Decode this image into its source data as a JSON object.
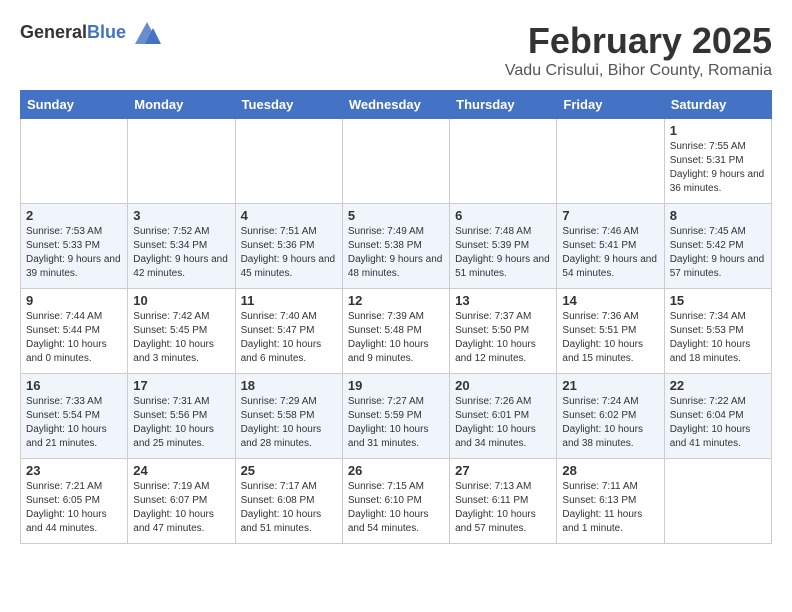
{
  "logo": {
    "general": "General",
    "blue": "Blue"
  },
  "title": "February 2025",
  "subtitle": "Vadu Crisului, Bihor County, Romania",
  "weekdays": [
    "Sunday",
    "Monday",
    "Tuesday",
    "Wednesday",
    "Thursday",
    "Friday",
    "Saturday"
  ],
  "weeks": [
    [
      {
        "day": "",
        "info": ""
      },
      {
        "day": "",
        "info": ""
      },
      {
        "day": "",
        "info": ""
      },
      {
        "day": "",
        "info": ""
      },
      {
        "day": "",
        "info": ""
      },
      {
        "day": "",
        "info": ""
      },
      {
        "day": "1",
        "info": "Sunrise: 7:55 AM\nSunset: 5:31 PM\nDaylight: 9 hours and 36 minutes."
      }
    ],
    [
      {
        "day": "2",
        "info": "Sunrise: 7:53 AM\nSunset: 5:33 PM\nDaylight: 9 hours and 39 minutes."
      },
      {
        "day": "3",
        "info": "Sunrise: 7:52 AM\nSunset: 5:34 PM\nDaylight: 9 hours and 42 minutes."
      },
      {
        "day": "4",
        "info": "Sunrise: 7:51 AM\nSunset: 5:36 PM\nDaylight: 9 hours and 45 minutes."
      },
      {
        "day": "5",
        "info": "Sunrise: 7:49 AM\nSunset: 5:38 PM\nDaylight: 9 hours and 48 minutes."
      },
      {
        "day": "6",
        "info": "Sunrise: 7:48 AM\nSunset: 5:39 PM\nDaylight: 9 hours and 51 minutes."
      },
      {
        "day": "7",
        "info": "Sunrise: 7:46 AM\nSunset: 5:41 PM\nDaylight: 9 hours and 54 minutes."
      },
      {
        "day": "8",
        "info": "Sunrise: 7:45 AM\nSunset: 5:42 PM\nDaylight: 9 hours and 57 minutes."
      }
    ],
    [
      {
        "day": "9",
        "info": "Sunrise: 7:44 AM\nSunset: 5:44 PM\nDaylight: 10 hours and 0 minutes."
      },
      {
        "day": "10",
        "info": "Sunrise: 7:42 AM\nSunset: 5:45 PM\nDaylight: 10 hours and 3 minutes."
      },
      {
        "day": "11",
        "info": "Sunrise: 7:40 AM\nSunset: 5:47 PM\nDaylight: 10 hours and 6 minutes."
      },
      {
        "day": "12",
        "info": "Sunrise: 7:39 AM\nSunset: 5:48 PM\nDaylight: 10 hours and 9 minutes."
      },
      {
        "day": "13",
        "info": "Sunrise: 7:37 AM\nSunset: 5:50 PM\nDaylight: 10 hours and 12 minutes."
      },
      {
        "day": "14",
        "info": "Sunrise: 7:36 AM\nSunset: 5:51 PM\nDaylight: 10 hours and 15 minutes."
      },
      {
        "day": "15",
        "info": "Sunrise: 7:34 AM\nSunset: 5:53 PM\nDaylight: 10 hours and 18 minutes."
      }
    ],
    [
      {
        "day": "16",
        "info": "Sunrise: 7:33 AM\nSunset: 5:54 PM\nDaylight: 10 hours and 21 minutes."
      },
      {
        "day": "17",
        "info": "Sunrise: 7:31 AM\nSunset: 5:56 PM\nDaylight: 10 hours and 25 minutes."
      },
      {
        "day": "18",
        "info": "Sunrise: 7:29 AM\nSunset: 5:58 PM\nDaylight: 10 hours and 28 minutes."
      },
      {
        "day": "19",
        "info": "Sunrise: 7:27 AM\nSunset: 5:59 PM\nDaylight: 10 hours and 31 minutes."
      },
      {
        "day": "20",
        "info": "Sunrise: 7:26 AM\nSunset: 6:01 PM\nDaylight: 10 hours and 34 minutes."
      },
      {
        "day": "21",
        "info": "Sunrise: 7:24 AM\nSunset: 6:02 PM\nDaylight: 10 hours and 38 minutes."
      },
      {
        "day": "22",
        "info": "Sunrise: 7:22 AM\nSunset: 6:04 PM\nDaylight: 10 hours and 41 minutes."
      }
    ],
    [
      {
        "day": "23",
        "info": "Sunrise: 7:21 AM\nSunset: 6:05 PM\nDaylight: 10 hours and 44 minutes."
      },
      {
        "day": "24",
        "info": "Sunrise: 7:19 AM\nSunset: 6:07 PM\nDaylight: 10 hours and 47 minutes."
      },
      {
        "day": "25",
        "info": "Sunrise: 7:17 AM\nSunset: 6:08 PM\nDaylight: 10 hours and 51 minutes."
      },
      {
        "day": "26",
        "info": "Sunrise: 7:15 AM\nSunset: 6:10 PM\nDaylight: 10 hours and 54 minutes."
      },
      {
        "day": "27",
        "info": "Sunrise: 7:13 AM\nSunset: 6:11 PM\nDaylight: 10 hours and 57 minutes."
      },
      {
        "day": "28",
        "info": "Sunrise: 7:11 AM\nSunset: 6:13 PM\nDaylight: 11 hours and 1 minute."
      },
      {
        "day": "",
        "info": ""
      }
    ]
  ]
}
